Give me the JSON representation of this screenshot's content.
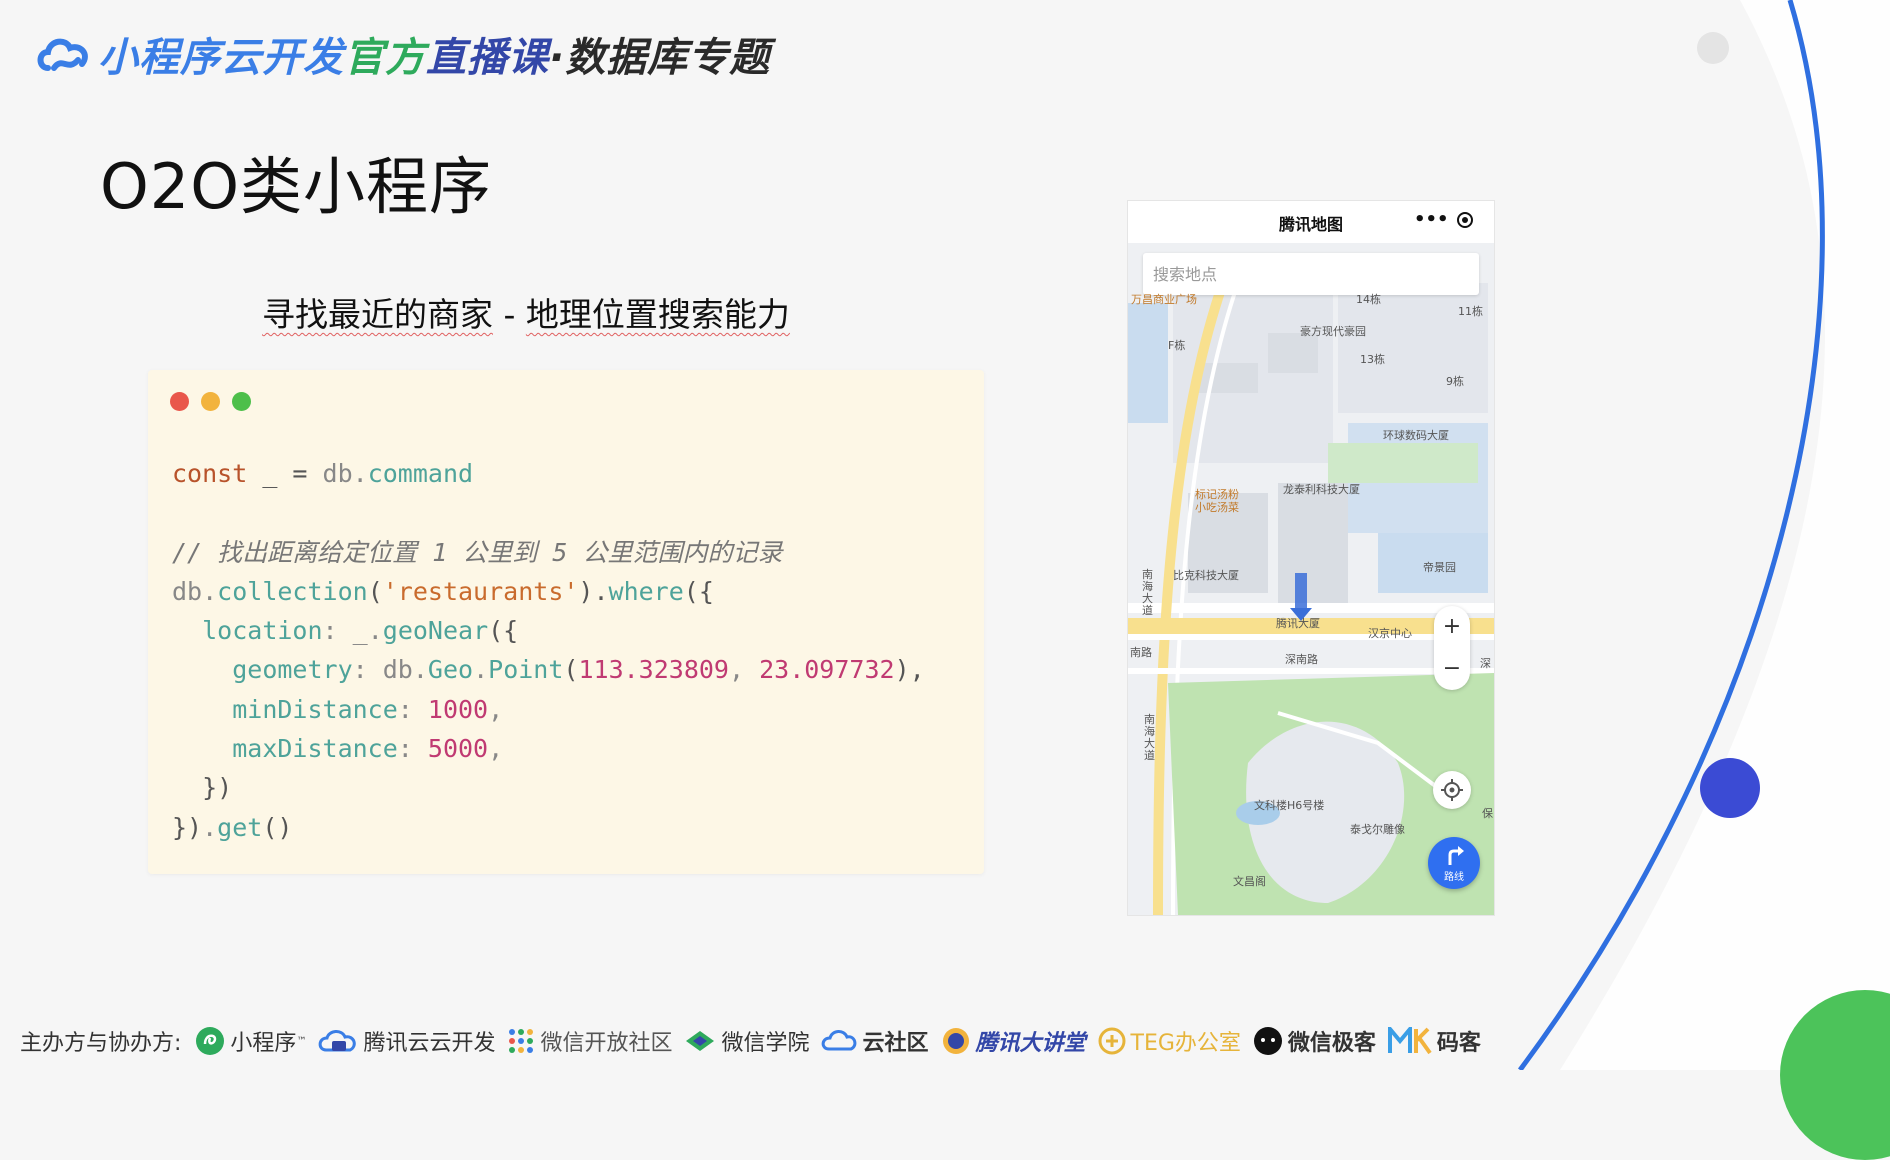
{
  "header": {
    "part1": "小程序云开发",
    "part2": "官方",
    "part3": "直播课",
    "part4": "·数据库专题",
    "colors": {
      "blue": "#3a7ee6",
      "green": "#2eaa5c",
      "navy": "#3347a8",
      "dark": "#2a2a2a"
    }
  },
  "slide": {
    "title": "O2O类小程序",
    "subtitle_a": "寻找最近的商家",
    "subtitle_sep": " - ",
    "subtitle_b": "地理位置搜索能力"
  },
  "code": {
    "window_dots": [
      "#e9574b",
      "#f2b33d",
      "#4dbf4a"
    ],
    "line1": {
      "kw": "const",
      "rest1": " _ = ",
      "obj": "db",
      "dot": ".",
      "prop": "command"
    },
    "comment": "// 找出距离给定位置 1 公里到 5 公里范围内的记录",
    "line3": {
      "obj": "db",
      "dot1": ".",
      "fn1": "collection",
      "open": "(",
      "str": "'restaurants'",
      "close": ").",
      "fn2": "where",
      "end": "({"
    },
    "line4": {
      "indent": "  ",
      "key": "location",
      "colon": ": ",
      "obj": "_",
      "dot": ".",
      "fn": "geoNear",
      "end": "({"
    },
    "line5": {
      "indent": "    ",
      "key": "geometry",
      "colon": ": ",
      "obj": "db",
      "dot1": ".",
      "cls": "Geo",
      "dot2": ".",
      "fn": "Point",
      "open": "(",
      "n1": "113.323809",
      "comma": ", ",
      "n2": "23.097732",
      "end": "),"
    },
    "line6": {
      "indent": "    ",
      "key": "minDistance",
      "colon": ": ",
      "val": "1000",
      "end": ","
    },
    "line7": {
      "indent": "    ",
      "key": "maxDistance",
      "colon": ": ",
      "val": "5000",
      "end": ","
    },
    "line8": "  })",
    "line9": {
      "open": "})",
      "dot": ".",
      "fn": "get",
      "end": "()"
    }
  },
  "phone": {
    "nav_title": "腾讯地图",
    "more_label": "•••",
    "search_placeholder": "搜索地点",
    "zoom_in": "+",
    "zoom_out": "−",
    "route_label": "路线",
    "map_labels": {
      "l1": "万昌商业广场",
      "l2": "14栋",
      "l3": "11栋",
      "l4": "豪方现代豪园",
      "l5": "F栋",
      "l6": "13栋",
      "l7": "9栋",
      "l8": "环球数码大厦",
      "l9": "龙泰利科技大厦",
      "l10": "标记汤粉",
      "l11": "小吃汤菜",
      "l12": "帝景园",
      "l13": "比克科技大厦",
      "l14": "腾讯大厦",
      "l15": "汉京中心",
      "l16": "深南路",
      "l17": "南路",
      "l18": "南海大道",
      "l19": "南海大道",
      "l20": "文科楼H6号楼",
      "l21": "泰戈尔雕像",
      "l22": "文昌阁",
      "l23": "深",
      "l24": "保"
    }
  },
  "footer": {
    "label": "主办方与协办方:",
    "sponsors": [
      {
        "name": "小程序",
        "sup": "™"
      },
      {
        "name": "腾讯云云开发"
      },
      {
        "name": "微信开放社区"
      },
      {
        "name": "微信学院"
      },
      {
        "name": "云社区"
      },
      {
        "name": "腾讯大讲堂"
      },
      {
        "name": "TEG办公室"
      },
      {
        "name": "微信极客"
      },
      {
        "name": "码客"
      }
    ]
  }
}
